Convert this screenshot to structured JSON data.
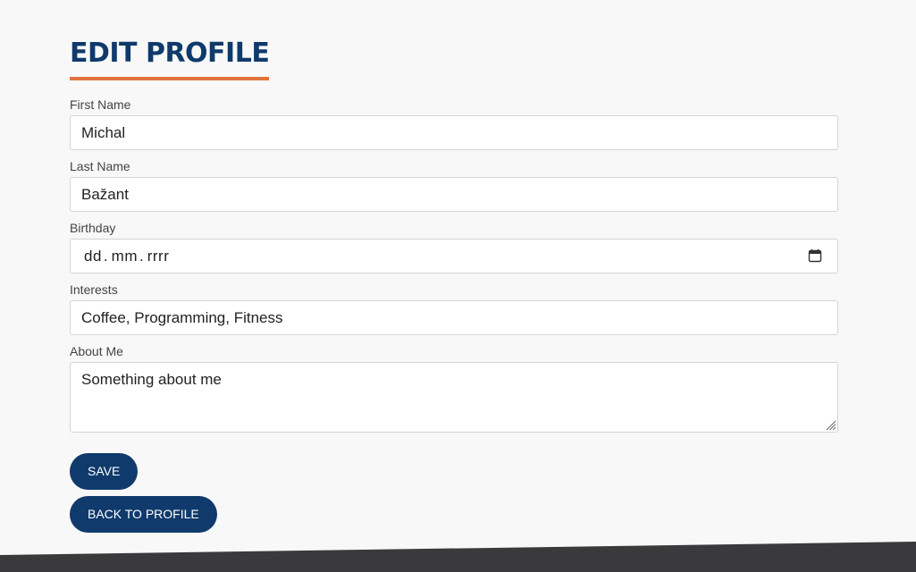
{
  "page": {
    "title": "EDIT PROFILE"
  },
  "form": {
    "first_name": {
      "label": "First Name",
      "value": "Michal"
    },
    "last_name": {
      "label": "Last Name",
      "value": "Bažant"
    },
    "birthday": {
      "label": "Birthday",
      "day_placeholder": "dd",
      "month_placeholder": "mm",
      "year_placeholder": "rrrr",
      "separator": "."
    },
    "interests": {
      "label": "Interests",
      "value": "Coffee, Programming, Fitness"
    },
    "about_me": {
      "label": "About Me",
      "value": "Something about me"
    }
  },
  "buttons": {
    "save_label": "SAVE",
    "back_label": "BACK TO PROFILE"
  },
  "colors": {
    "primary": "#0f3a6b",
    "accent": "#e0723f",
    "footer": "#3a3a3c",
    "background": "#f8f8f8"
  },
  "icons": {
    "calendar": "calendar-icon",
    "resize": "resize-handle-icon"
  }
}
